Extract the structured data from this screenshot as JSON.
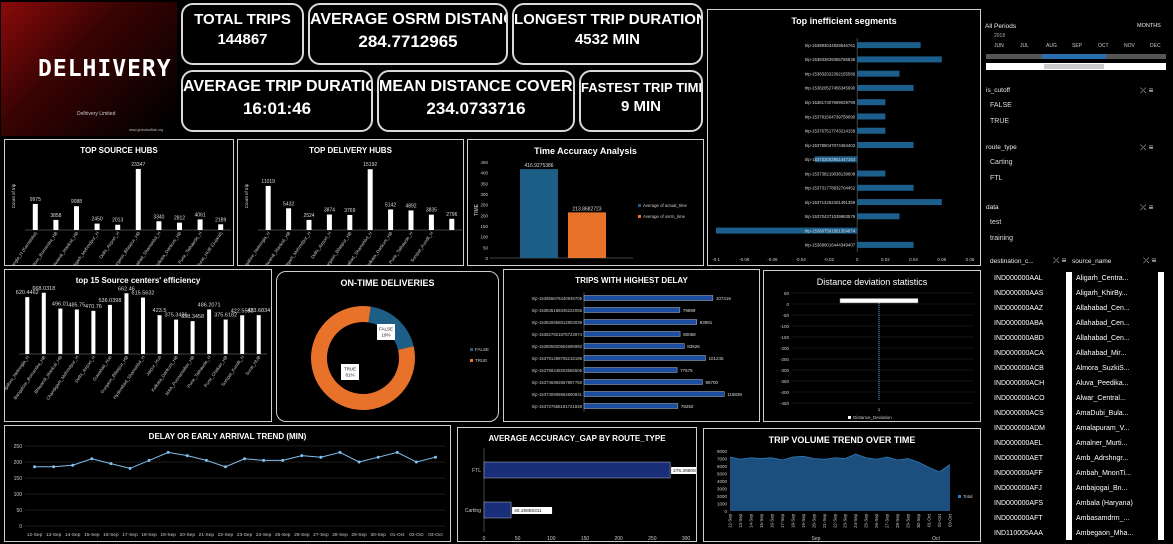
{
  "brand": {
    "name": "DELHIVERY",
    "sub": "Delhivery Limited",
    "tiny": "www.globalsoftlab.org"
  },
  "kpis": {
    "total_trips": {
      "label": "TOTAL TRIPS",
      "value": "144867"
    },
    "avg_osrm": {
      "label": "AVERAGE OSRM DISTANCE",
      "value": "284.7712965"
    },
    "longest": {
      "label": "LONGEST TRIP DURATION",
      "value": "4532 MIN"
    },
    "avg_duration": {
      "label": "AVERAGE TRIP DURATION",
      "value": "16:01:46"
    },
    "mean_distance": {
      "label": "MEAN DISTANCE COVERED",
      "value": "234.0733716"
    },
    "fastest": {
      "label": "FASTEST TRIP TIME",
      "value": "9 MIN"
    }
  },
  "panels": {
    "top_source": "TOP SOURCE HUBS",
    "top_delivery": "TOP DELIVERY HUBS",
    "time_accuracy": "Time Accuracy Analysis",
    "inefficient": "Top inefficient segments",
    "efficiency": "top 15 Source centers' efficiency",
    "ontime": "ON-TIME DELIVERIES",
    "highest_delay": "TRIPS WITH HIGHEST DELAY",
    "deviation": "Distance deviation statistics",
    "delay_trend": "DELAY OR EARLY ARRIVAL TREND (MIN)",
    "accuracy_gap": "AVERAGE ACCURACY_GAP BY ROUTE_TYPE",
    "volume_trend": "TRIP VOLUME TREND OVER TIME"
  },
  "chart_data": [
    {
      "type": "bar",
      "title": "TOP SOURCE HUBS",
      "ylabel": "Count of trip",
      "categories": [
        "Bangalore_Nelmngla_H (Karnataka)",
        "Bangalore_Bomsndra_HB",
        "Bhiwandi_Mankoli_HB",
        "Chandigarh_Mehmdpur_H",
        "Delhi_Airport_H",
        "Gurgaon_Bilaspur_HB",
        "Hyderabad_Shamshbd_H",
        "Kolkata_Dankuni_HB",
        "Pune_Tathawde_H",
        "Surat_HUB (Gujarat)"
      ],
      "values": [
        9975,
        3858,
        9088,
        2450,
        2013,
        23347,
        3340,
        2812,
        4061,
        2189
      ]
    },
    {
      "type": "bar",
      "title": "TOP DELIVERY HUBS",
      "ylabel": "Count of trip",
      "categories": [
        "Bangalore_Nelmngla_H",
        "Bhiwandi_Mankoli_HB",
        "Chandigarh_Mehmdpur_H",
        "Delhi_Airport_H",
        "Gurgaon_Bilaspur_HB",
        "Hyderabad_Shamshbd_H",
        "Kolkata_Dankuni_HB",
        "Pune_Tathawde_H",
        "Sonipat_Kundli_H"
      ],
      "values": [
        11019,
        5432,
        2524,
        3874,
        3769,
        15192,
        5142,
        4892,
        3835,
        2796
      ]
    },
    {
      "type": "bar",
      "title": "Time Accuracy Analysis",
      "ylabel": "TIME",
      "categories": [
        "Average of actual_time",
        "Average of osrm_time"
      ],
      "values": [
        416.9275386,
        213.8682723
      ],
      "ylim": [
        0,
        450
      ]
    },
    {
      "type": "bar",
      "title": "Top inefficient segments",
      "categories": [
        "trip-153893044928546761",
        "trip-153833839355765836",
        "trip-153832022392155586",
        "trip-153820527456345690",
        "trip-153817307699029790",
        "trip-153781504739758090",
        "trip-153767517743214158",
        "trip-153785047074484403",
        "trip-153733003951447154",
        "trip-153738219038139608",
        "trip-153731778832704452",
        "trip-153714252401491359",
        "trip-153704371039983579",
        "trip-153687591851354874",
        "trip-153680016444349407"
      ],
      "values": [
        0.045,
        0.06,
        0.03,
        0.04,
        0.02,
        0.02,
        0.02,
        0.04,
        -0.03,
        0.02,
        0.04,
        0.06,
        0.03,
        -0.1,
        0.04
      ],
      "xlim": [
        -0.1,
        0.08
      ]
    },
    {
      "type": "bar",
      "title": "top 15 Source centers' efficiency",
      "categories": [
        "Bangalore_Nelmngla_H",
        "Bangalore_Bomsndra_HB",
        "Bhiwandi_Mankoli_HB",
        "Chandigarh_Mehmdpur_H",
        "Delhi_Airport_H",
        "Guwahati_Hub",
        "Gurgaon_Bilaspur_HB",
        "Hyderabad_Shamshbd_H",
        "Jaipur_Hub",
        "Kolkata_Dankuni_HB",
        "MAA_Poonamallee_HB",
        "Pune_Tathawde_H",
        "Pune_Chakan_HB",
        "Sonipat_Kundli_H",
        "Surat_HUB"
      ],
      "values": [
        620.4462,
        668.0318,
        496.01,
        485.75,
        470.76,
        536.0398,
        662.46,
        615.5632,
        423.5,
        375.3426,
        358.3458,
        486.2071,
        375.6182,
        422.5588,
        423.6834
      ]
    },
    {
      "type": "pie",
      "title": "ON-TIME DELIVERIES",
      "categories": [
        "FALSE",
        "TRUE"
      ],
      "values": [
        19,
        81
      ]
    },
    {
      "type": "bar",
      "title": "TRIPS WITH HIGHEST DELAY",
      "categories": [
        "trip-153856676340948705",
        "trip-153845188345222055",
        "trip-153840656812803039",
        "trip-153827821875723974",
        "trip-153805920654695992",
        "trip-153791498705218196",
        "trip-153768248203565505",
        "trip-153746992867897750",
        "trip-153740908964800931",
        "trip-153727658181721848"
      ],
      "values": [
        107416,
        79899,
        93991,
        80068,
        83526,
        101245,
        77575,
        98700,
        116838,
        78250
      ]
    },
    {
      "type": "box",
      "title": "Distance deviation statistics",
      "categories": [
        "Distance_Deviation"
      ],
      "ylim": [
        -450,
        50
      ]
    },
    {
      "type": "line",
      "title": "DELAY OR EARLY ARRIVAL TREND (MIN)",
      "x": [
        "12-Sep",
        "13-Sep",
        "14-Sep",
        "15-Sep",
        "16-Sep",
        "17-Sep",
        "18-Sep",
        "19-Sep",
        "20-Sep",
        "21-Sep",
        "22-Sep",
        "23-Sep",
        "24-Sep",
        "25-Sep",
        "26-Sep",
        "27-Sep",
        "28-Sep",
        "29-Sep",
        "30-Sep",
        "01-Oct",
        "02-Oct",
        "03-Oct"
      ],
      "values": [
        185,
        185,
        190,
        210,
        195,
        180,
        205,
        230,
        220,
        205,
        185,
        210,
        205,
        205,
        220,
        215,
        230,
        200,
        215,
        230,
        200,
        215
      ],
      "ylim": [
        0,
        250
      ]
    },
    {
      "type": "bar",
      "title": "AVERAGE ACCURACY_GAP BY ROUTE_TYPE",
      "categories": [
        "FTL",
        "Carting"
      ],
      "values": [
        276.3960889,
        40.19859311
      ],
      "xlim": [
        0,
        300
      ]
    },
    {
      "type": "area",
      "title": "TRIP VOLUME TREND OVER TIME",
      "x": [
        "12-Sep",
        "13-Sep",
        "14-Sep",
        "15-Sep",
        "16-Sep",
        "17-Sep",
        "18-Sep",
        "19-Sep",
        "20-Sep",
        "21-Sep",
        "22-Sep",
        "23-Sep",
        "24-Sep",
        "25-Sep",
        "26-Sep",
        "27-Sep",
        "28-Sep",
        "29-Sep",
        "30-Sep",
        "01-Oct",
        "02-Oct",
        "03-Oct"
      ],
      "values": [
        7200,
        6900,
        7100,
        7000,
        7100,
        6800,
        7200,
        7300,
        7000,
        6900,
        7100,
        7000,
        7600,
        7100,
        6900,
        7200,
        6800,
        7000,
        6500,
        5800,
        5200,
        6200
      ],
      "series_name": "Total",
      "ylim": [
        0,
        8000
      ]
    }
  ],
  "slicers": {
    "periods": "All Periods",
    "months_label": "MONTHS",
    "year": "2018",
    "months": [
      "JUN",
      "JUL",
      "AUG",
      "SEP",
      "OCT",
      "NOV",
      "DEC"
    ],
    "is_cutoff": {
      "title": "is_cutoff",
      "items": [
        "FALSE",
        "TRUE"
      ]
    },
    "route_type": {
      "title": "route_type",
      "items": [
        "Carting",
        "FTL"
      ]
    },
    "data": {
      "title": "data",
      "items": [
        "test",
        "training"
      ]
    },
    "dest_title": "destination_c...",
    "source_title": "source_name",
    "destinations": [
      "IND000000AAL",
      "IND000000AAS",
      "IND000000AAZ",
      "IND000000ABA",
      "IND000000ABD",
      "IND000000ACA",
      "IND000000ACB",
      "IND000000ACH",
      "IND000000ACO",
      "IND000000ACS",
      "IND000000ADM",
      "IND000000AEL",
      "IND000000AET",
      "IND000000AFF",
      "IND000000AFJ",
      "IND000000AFS",
      "IND000000AFT",
      "IND110005AAA"
    ],
    "sources": [
      "Aligarh_Centra...",
      "Aligarh_KhirBy...",
      "Allahabad_Cen...",
      "Allahabad_Cen...",
      "Allahabad_Cen...",
      "Allahabad_Mir...",
      "Almora_SuzkiS...",
      "Aluva_Peedika...",
      "Alwar_Central...",
      "AmaDubi_Bula...",
      "Amalapuram_V...",
      "Amalner_Murti...",
      "Amb_Adrshngr...",
      "Ambah_MnonTi...",
      "Ambajogai_Bn...",
      "Ambala (Haryana)",
      "Ambasamdrm_...",
      "Ambegaon_Mha..."
    ]
  }
}
